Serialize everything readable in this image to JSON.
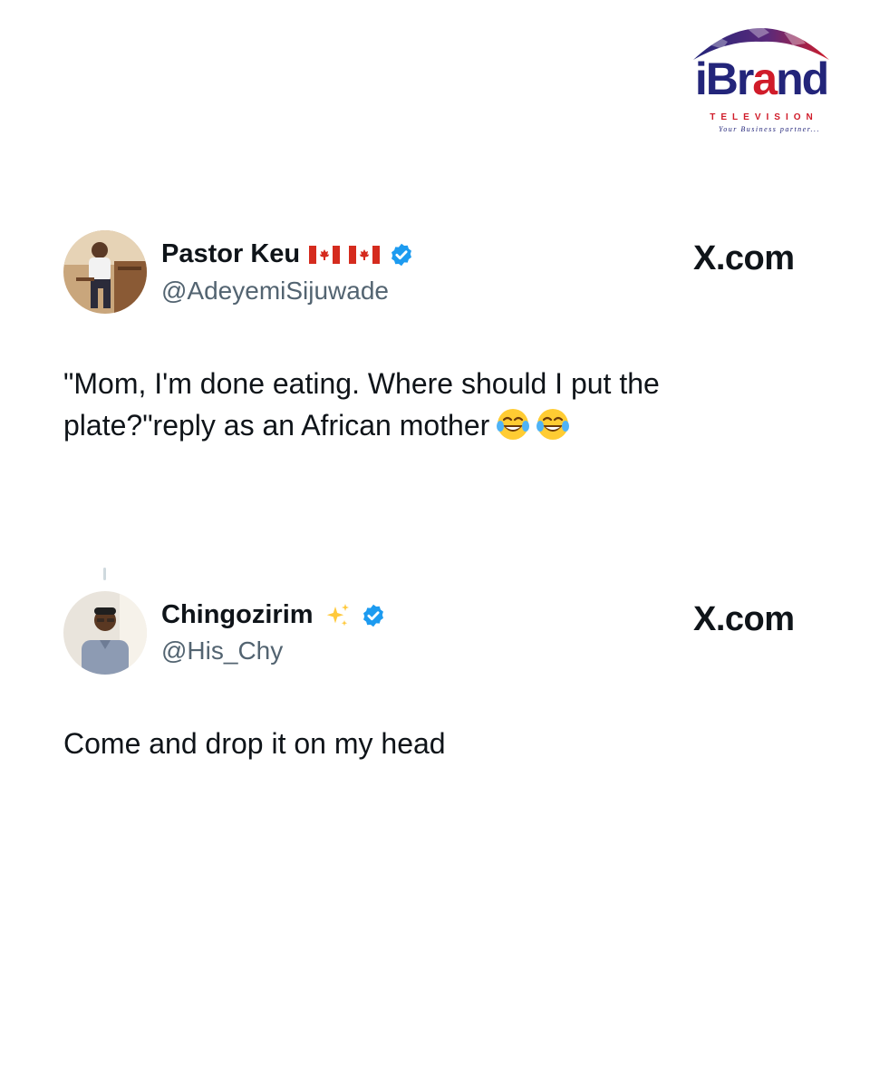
{
  "brand": {
    "wordmark_left": "iBr",
    "wordmark_highlight": "a",
    "wordmark_right": "nd",
    "subtitle": "TELEVISION",
    "tagline": "Your Business partner..."
  },
  "tweets": [
    {
      "display_name": "Pastor Keu",
      "badges": [
        "canada-flag",
        "canada-flag",
        "verified-badge"
      ],
      "handle": "@AdeyemiSijuwade",
      "source": "X.com",
      "text": "\"Mom, I'm done eating. Where should I put the plate?\"reply as an African mother",
      "trailing_emoji": [
        "face-with-tears-of-joy",
        "face-with-tears-of-joy"
      ]
    },
    {
      "display_name": "Chingozirim",
      "badges": [
        "sparkles",
        "verified-badge"
      ],
      "handle": "@His_Chy",
      "source": "X.com",
      "text": "Come and drop it on my head"
    }
  ],
  "colors": {
    "text_primary": "#0f1419",
    "text_secondary": "#536471",
    "verified_blue": "#1d9bf0",
    "brand_navy": "#23257a",
    "brand_red": "#d01c2a"
  }
}
